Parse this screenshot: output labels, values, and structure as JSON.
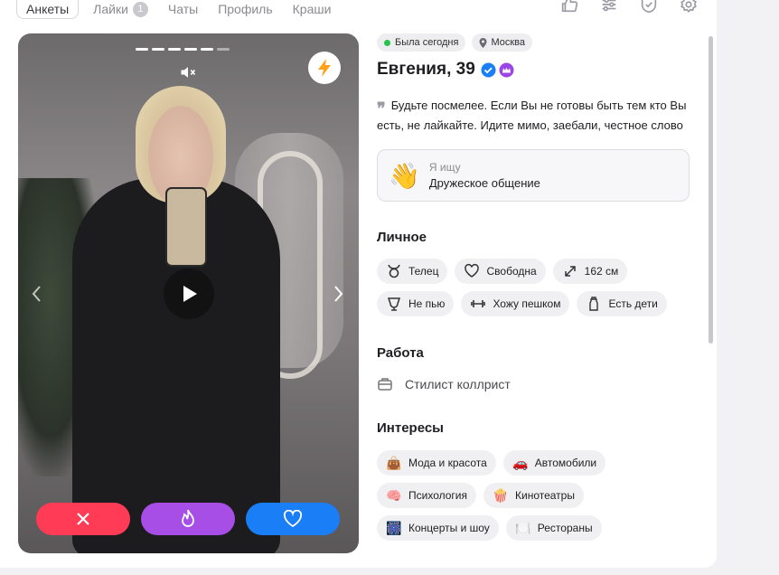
{
  "nav": {
    "tabs": [
      {
        "label": "Анкеты"
      },
      {
        "label": "Лайки",
        "badge": "1"
      },
      {
        "label": "Чаты"
      },
      {
        "label": "Профиль"
      },
      {
        "label": "Краши"
      }
    ],
    "icons": [
      "thumbs-up-icon",
      "sliders-icon",
      "shield-check-icon",
      "gear-icon"
    ]
  },
  "profile": {
    "status": "Была сегодня",
    "city": "Москва",
    "name_age": "Евгения, 39",
    "quote": "Будьте посмелее. Если Вы не готовы быть тем кто Вы есть, не лайкайте. Идите мимо, заебали, честное слово",
    "seeking_label": "Я ищу",
    "seeking_value": "Дружеское общение",
    "seeking_emoji": "👋"
  },
  "personal": {
    "title": "Личное",
    "chips": [
      {
        "icon": "taurus-icon",
        "label": "Телец"
      },
      {
        "icon": "heart-outline-icon",
        "label": "Свободна"
      },
      {
        "icon": "expand-icon",
        "label": "162 см"
      },
      {
        "icon": "glass-icon",
        "label": "Не пью"
      },
      {
        "icon": "dumbbell-icon",
        "label": "Хожу пешком"
      },
      {
        "icon": "baby-bottle-icon",
        "label": "Есть дети"
      }
    ]
  },
  "work": {
    "title": "Работа",
    "value": "Стилист коллрист"
  },
  "interests": {
    "title": "Интересы",
    "chips": [
      {
        "emoji": "👜",
        "label": "Мода и красота"
      },
      {
        "emoji": "🚗",
        "label": "Автомобили"
      },
      {
        "emoji": "🧠",
        "label": "Психология"
      },
      {
        "emoji": "🍿",
        "label": "Кинотеатры"
      },
      {
        "emoji": "🎆",
        "label": "Концерты и шоу"
      },
      {
        "emoji": "🍽️",
        "label": "Рестораны"
      }
    ]
  },
  "photo": {
    "progress_total": 6,
    "progress_active": 5
  },
  "colors": {
    "dislike": "#ff3b55",
    "superlike": "#a64ee6",
    "like": "#1a7ef7",
    "online": "#27c24c"
  }
}
